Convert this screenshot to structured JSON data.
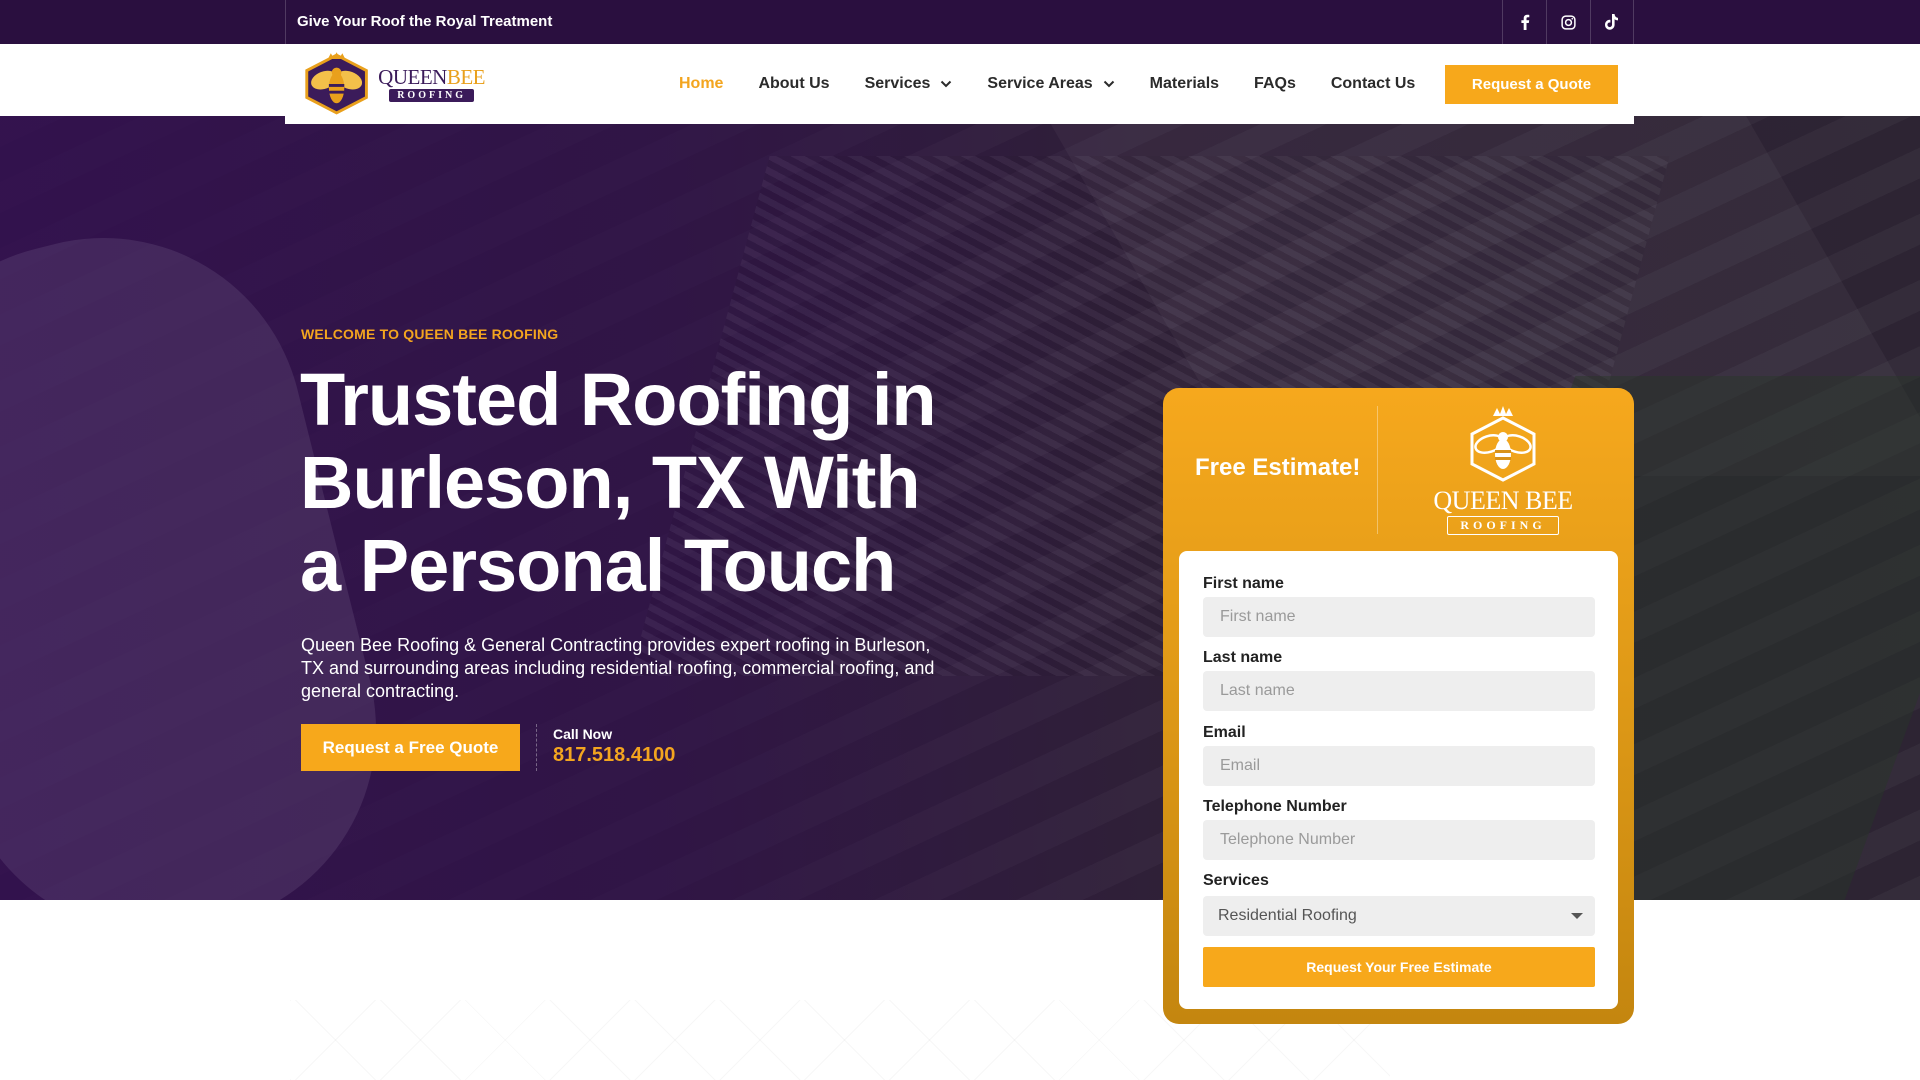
{
  "topbar": {
    "tagline": "Give Your Roof the Royal Treatment",
    "socials": [
      {
        "icon": "facebook-icon"
      },
      {
        "icon": "instagram-icon"
      },
      {
        "icon": "tiktok-icon"
      }
    ]
  },
  "header": {
    "logo": {
      "queen": "QUEEN",
      "bee": "BEE",
      "roofing": "ROOFING"
    },
    "nav": [
      {
        "label": "Home",
        "active": true
      },
      {
        "label": "About Us"
      },
      {
        "label": "Services",
        "dropdown": true
      },
      {
        "label": "Service Areas",
        "dropdown": true
      },
      {
        "label": "Materials"
      },
      {
        "label": "FAQs"
      },
      {
        "label": "Contact Us"
      }
    ],
    "quote_button": "Request a Quote"
  },
  "hero": {
    "eyebrow": "WELCOME TO QUEEN BEE ROOFING",
    "headline": "Trusted Roofing in Burleson, TX With a Personal Touch",
    "subtext": "Queen Bee Roofing & General Contracting provides expert roofing in Burleson, TX and surrounding areas including residential roofing, commercial roofing, and general contracting.",
    "cta_button": "Request a Free Quote",
    "call_label": "Call Now",
    "call_number": "817.518.4100"
  },
  "estimate": {
    "title": "Free Estimate!",
    "logo": {
      "queen": "QUEEN",
      "bee": "BEE",
      "roofing": "ROOFING"
    },
    "fields": {
      "first_name": {
        "label": "First name",
        "placeholder": "First name"
      },
      "last_name": {
        "label": "Last name",
        "placeholder": "Last name"
      },
      "email": {
        "label": "Email",
        "placeholder": "Email"
      },
      "phone": {
        "label": "Telephone Number",
        "placeholder": "Telephone Number"
      },
      "services": {
        "label": "Services",
        "selected": "Residential Roofing"
      }
    },
    "submit": "Request Your Free Estimate"
  },
  "colors": {
    "purple": "#2a0f3f",
    "gold": "#f7a81b"
  }
}
